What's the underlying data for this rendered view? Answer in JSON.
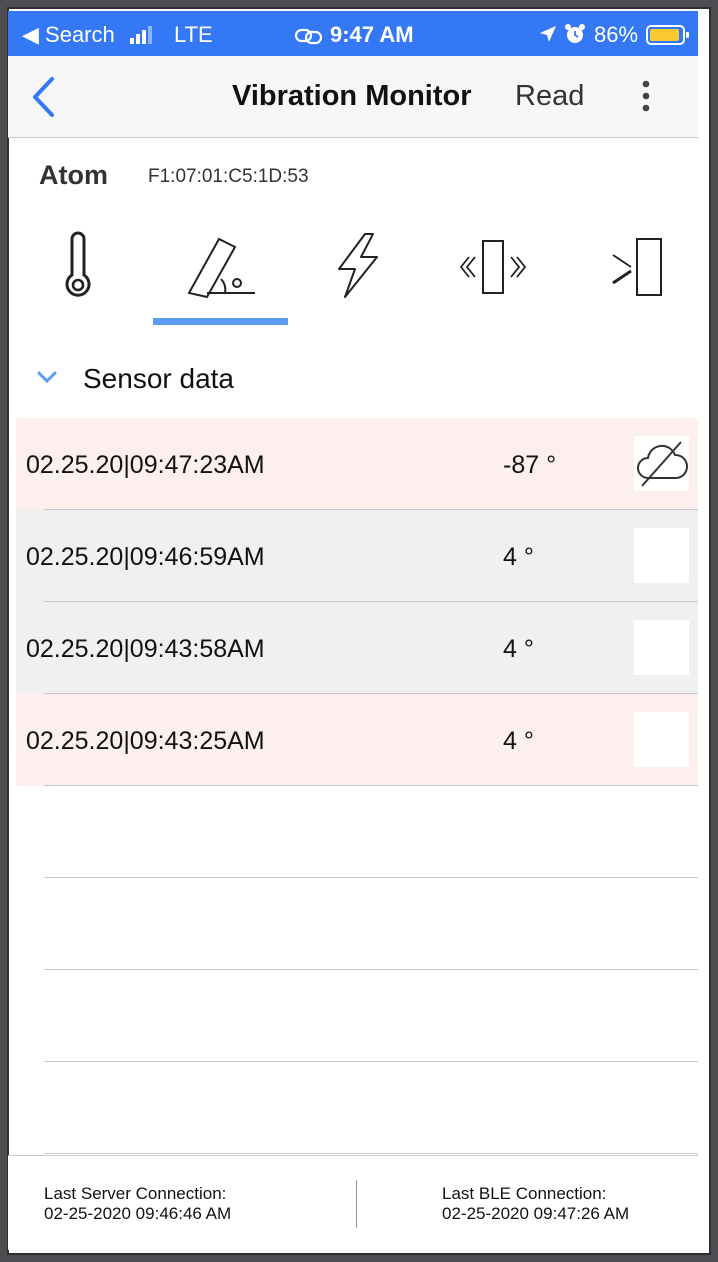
{
  "status_bar": {
    "back_app": "◀ Search",
    "carrier": "LTE",
    "time": "9:47 AM",
    "battery": "86%"
  },
  "nav": {
    "title": "Vibration Monitor",
    "action": "Read"
  },
  "device": {
    "name": "Atom",
    "address": "F1:07:01:C5:1D:53"
  },
  "tabs": [
    {
      "icon": "thermometer-icon"
    },
    {
      "icon": "tilt-angle-icon",
      "selected": true
    },
    {
      "icon": "lightning-icon"
    },
    {
      "icon": "vibration-icon"
    },
    {
      "icon": "proximity-icon"
    }
  ],
  "section": {
    "title": "Sensor data"
  },
  "readings": [
    {
      "timestamp": "02.25.20|09:47:23AM",
      "value": "-87 °",
      "cloud_icon": "cloud-off-icon",
      "highlight": "#fcefed"
    },
    {
      "timestamp": "02.25.20|09:46:59AM",
      "value": "4 °",
      "highlight": "#f0f0f0"
    },
    {
      "timestamp": "02.25.20|09:43:58AM",
      "value": "4 °",
      "highlight": "#f0f0f0"
    },
    {
      "timestamp": "02.25.20|09:43:25AM",
      "value": "4 °",
      "highlight": "#fcefed"
    }
  ],
  "footer": {
    "server_label": "Last Server Connection:",
    "server_time": "02-25-2020 09:46:46 AM",
    "ble_label": "Last BLE Connection:",
    "ble_time": "02-25-2020 09:47:26 AM"
  },
  "colors": {
    "accent": "#3478f6",
    "tab_indicator": "#5b9bf0",
    "alert_row": "#fcefed",
    "normal_row": "#f0f0f0"
  }
}
